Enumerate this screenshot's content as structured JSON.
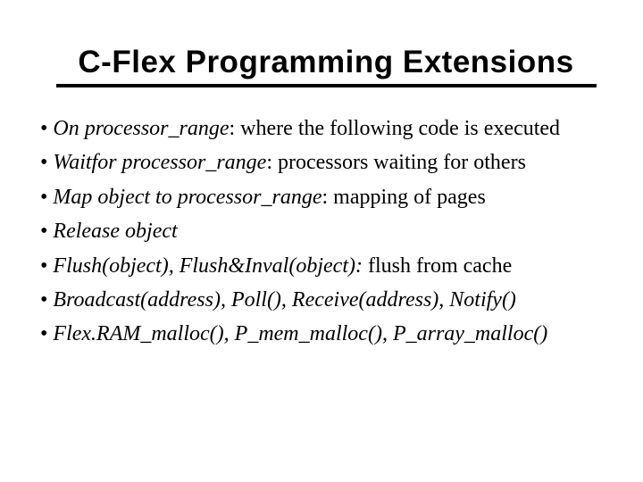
{
  "title": "C-Flex Programming Extensions",
  "bullets": [
    {
      "em": "On processor_range",
      "rest": ":  where the following code is executed",
      "gap": false
    },
    {
      "em": "Waitfor processor_range",
      "rest": ": processors waiting for others",
      "gap": true
    },
    {
      "em": "Map object to processor_range",
      "rest": ": mapping of pages",
      "gap": false
    },
    {
      "em": "Release object",
      "rest": "",
      "gap": true
    },
    {
      "em": "Flush(object),  Flush&Inval(object):",
      "rest": "   flush from cache",
      "gap": false
    },
    {
      "em": "Broadcast(address), Poll(), Receive(address), Notify()",
      "rest": "",
      "gap": true
    },
    {
      "em": "Flex.RAM_malloc(), P_mem_malloc(), P_array_malloc()",
      "rest": "",
      "gap": true
    }
  ]
}
